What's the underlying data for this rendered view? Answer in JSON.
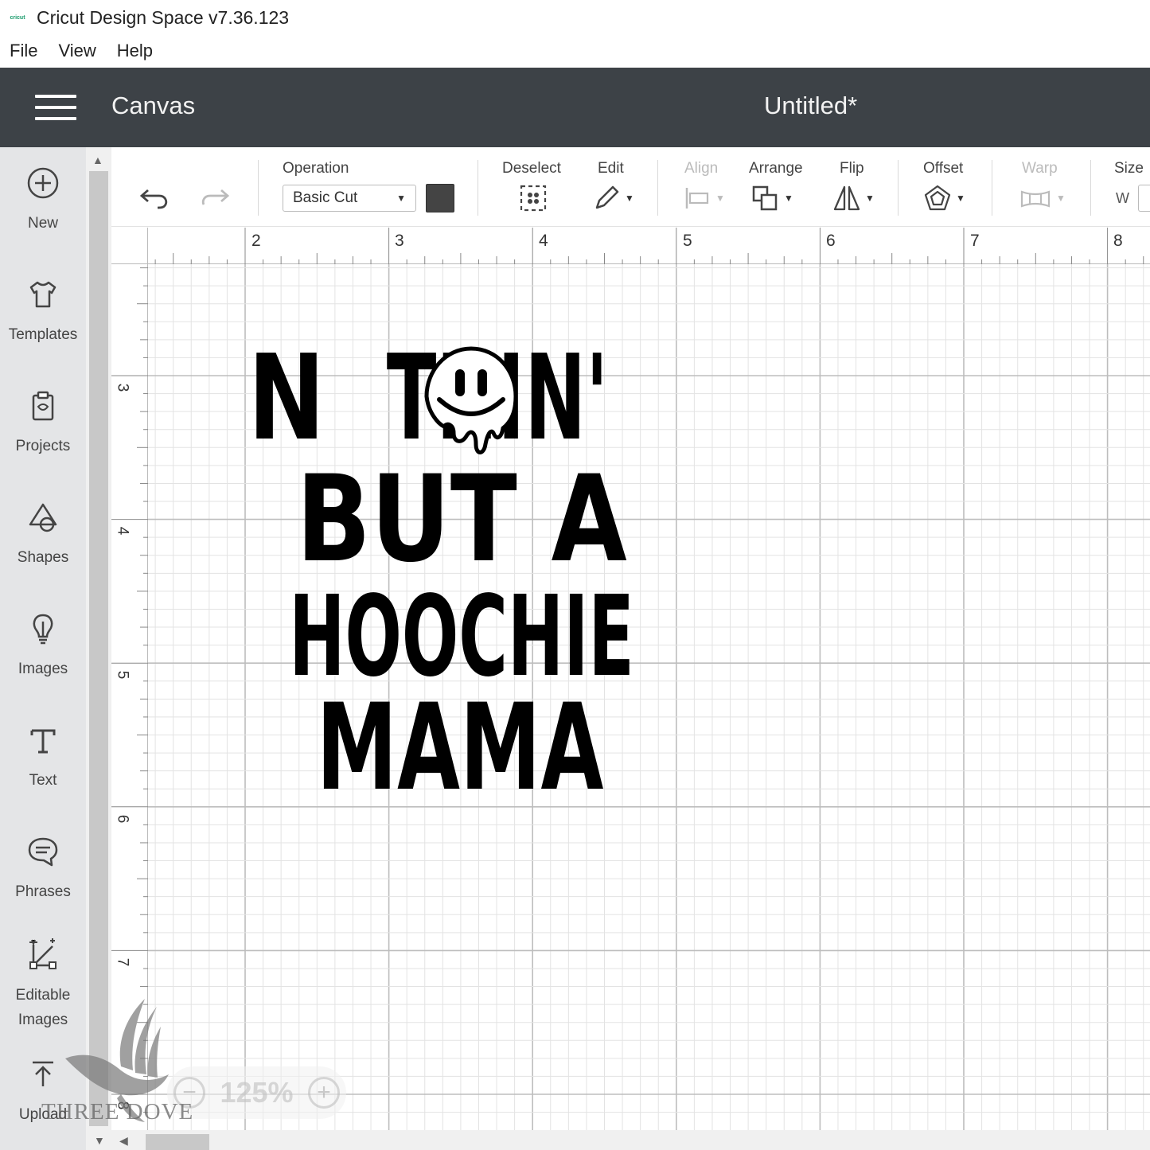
{
  "window": {
    "title": "Cricut Design Space  v7.36.123",
    "logo_text": "cricut"
  },
  "menu": [
    "File",
    "View",
    "Help"
  ],
  "header": {
    "title": "Canvas",
    "document": "Untitled*"
  },
  "sidebar": [
    {
      "label": "New",
      "icon": "plus-circle-icon"
    },
    {
      "label": "Templates",
      "icon": "tshirt-icon"
    },
    {
      "label": "Projects",
      "icon": "clipboard-icon"
    },
    {
      "label": "Shapes",
      "icon": "shapes-icon"
    },
    {
      "label": "Images",
      "icon": "lightbulb-icon"
    },
    {
      "label": "Text",
      "icon": "text-icon"
    },
    {
      "label": "Phrases",
      "icon": "speech-bubble-icon"
    },
    {
      "label": "Editable Images",
      "icon": "editable-image-icon"
    },
    {
      "label": "Upload",
      "icon": "upload-icon"
    }
  ],
  "toolbar": {
    "operation_label": "Operation",
    "operation_value": "Basic Cut",
    "operation_color": "#444444",
    "deselect_label": "Deselect",
    "edit_label": "Edit",
    "align_label": "Align",
    "arrange_label": "Arrange",
    "flip_label": "Flip",
    "offset_label": "Offset",
    "warp_label": "Warp",
    "size_label": "Size",
    "size_w_label": "W"
  },
  "rulers": {
    "horizontal": [
      "2",
      "2",
      "3",
      "4",
      "5",
      "6",
      "7",
      "8"
    ],
    "vertical": [
      "3",
      "4",
      "5",
      "6",
      "7",
      "8"
    ]
  },
  "design": {
    "lines": [
      "NOTHIN'",
      "BUT A",
      "HOOCHIE",
      "MAMA"
    ],
    "color": "#000000"
  },
  "zoom": {
    "value": "125%",
    "minus": "−",
    "plus": "+"
  },
  "watermark": {
    "text": "THREE DOVE"
  }
}
